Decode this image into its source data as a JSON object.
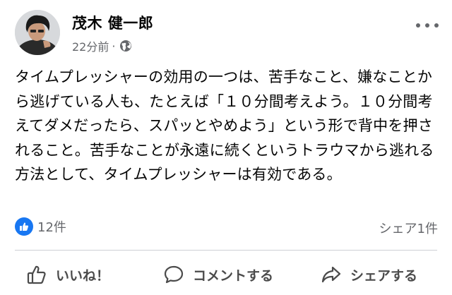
{
  "post": {
    "author": "茂木 健一郎",
    "time": "22分前",
    "separator": "·",
    "privacy_icon": "globe-icon",
    "menu_icon": "more-options-icon",
    "message": "タイムプレッシャーの効用の一つは、苦手なこと、嫌なことから逃げている人も、たとえば「１０分間考えよう。１０分間考えてダメだったら、スパッとやめよう」という形で背中を押されること。苦手なことが永遠に続くというトラウマから逃れる方法として、タイムプレッシャーは有効である。"
  },
  "stats": {
    "like_icon": "thumbs-up-icon",
    "likes": "12件",
    "shares": "シェア1件"
  },
  "actions": {
    "like": {
      "label": "いいね！",
      "icon": "thumbs-up-outline-icon"
    },
    "comment": {
      "label": "コメントする",
      "icon": "speech-bubble-icon"
    },
    "share": {
      "label": "シェアする",
      "icon": "share-arrow-icon"
    }
  },
  "colors": {
    "accent": "#1877f2",
    "secondary_text": "#65676b",
    "divider": "#ced0d4"
  }
}
